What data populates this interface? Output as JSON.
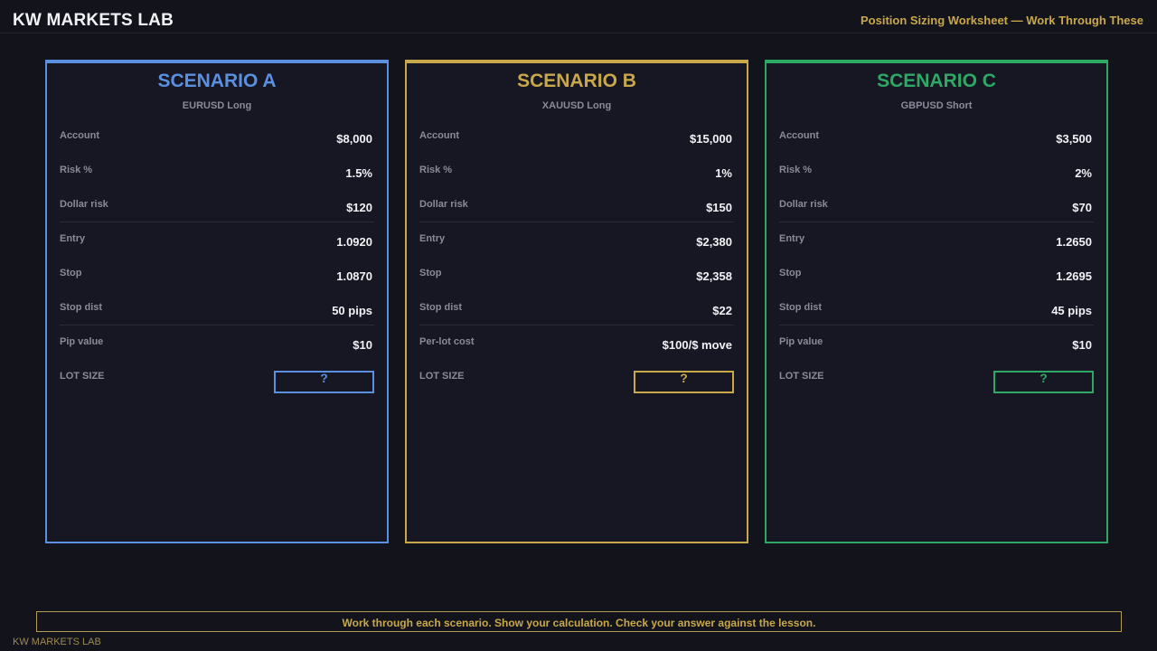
{
  "app": {
    "brand": "KW MARKETS LAB",
    "subtitle": "Position Sizing Worksheet — Work Through These"
  },
  "scenarios": [
    {
      "title": "SCENARIO A",
      "pair": "EURUSD Long",
      "color": "#5b8fe0",
      "rows": [
        {
          "label": "Account",
          "value": "$8,000"
        },
        {
          "label": "Risk %",
          "value": "1.5%"
        },
        {
          "label": "Dollar risk",
          "value": "$120"
        },
        {
          "label": "Entry",
          "value": "1.0920"
        },
        {
          "label": "Stop",
          "value": "1.0870"
        },
        {
          "label": "Stop dist",
          "value": "50 pips"
        },
        {
          "label": "Pip value",
          "value": "$10"
        }
      ],
      "lot_label": "LOT SIZE",
      "lot_value": "?"
    },
    {
      "title": "SCENARIO B",
      "pair": "XAUUSD Long",
      "color": "#c9a84b",
      "rows": [
        {
          "label": "Account",
          "value": "$15,000"
        },
        {
          "label": "Risk %",
          "value": "1%"
        },
        {
          "label": "Dollar risk",
          "value": "$150"
        },
        {
          "label": "Entry",
          "value": "$2,380"
        },
        {
          "label": "Stop",
          "value": "$2,358"
        },
        {
          "label": "Stop dist",
          "value": "$22"
        },
        {
          "label": "Per-lot cost",
          "value": "$100/$ move"
        }
      ],
      "lot_label": "LOT SIZE",
      "lot_value": "?"
    },
    {
      "title": "SCENARIO C",
      "pair": "GBPUSD Short",
      "color": "#2ea865",
      "rows": [
        {
          "label": "Account",
          "value": "$3,500"
        },
        {
          "label": "Risk %",
          "value": "2%"
        },
        {
          "label": "Dollar risk",
          "value": "$70"
        },
        {
          "label": "Entry",
          "value": "1.2650"
        },
        {
          "label": "Stop",
          "value": "1.2695"
        },
        {
          "label": "Stop dist",
          "value": "45 pips"
        },
        {
          "label": "Pip value",
          "value": "$10"
        }
      ],
      "lot_label": "LOT SIZE",
      "lot_value": "?"
    }
  ],
  "footer": {
    "instruction": "Work through each scenario. Show your calculation. Check your answer against the lesson.",
    "brand": "KW MARKETS LAB"
  }
}
